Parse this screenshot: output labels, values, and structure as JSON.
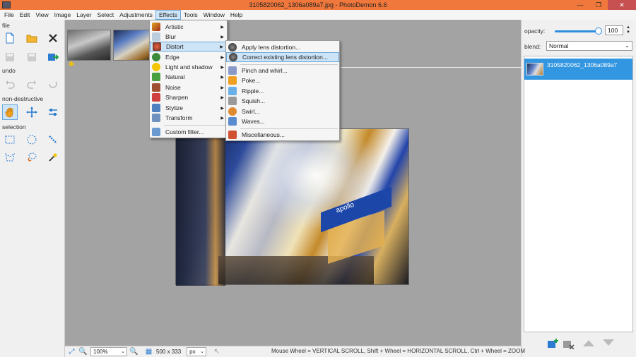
{
  "window": {
    "title": "3105820062_1306a089a7.jpg  -  PhotoDemon 6.6",
    "min": "—",
    "max": "❐",
    "close": "✕"
  },
  "menubar": [
    "File",
    "Edit",
    "View",
    "Image",
    "Layer",
    "Select",
    "Adjustments",
    "Effects",
    "Tools",
    "Window",
    "Help"
  ],
  "active_menu": "Effects",
  "toolbox": {
    "file_label": "file",
    "undo_label": "undo",
    "nondestructive_label": "non-destructive",
    "selection_label": "selection"
  },
  "effects_menu": {
    "items": [
      "Artistic",
      "Blur",
      "Distort",
      "Edge",
      "Light and shadow",
      "Natural",
      "Noise",
      "Sharpen",
      "Stylize",
      "Transform"
    ],
    "custom": "Custom filter...",
    "highlighted": "Distort"
  },
  "distort_menu": {
    "items": [
      "Apply lens distortion...",
      "Correct existing lens distortion..."
    ],
    "items2": [
      "Pinch and whirl...",
      "Poke...",
      "Ripple...",
      "Squish...",
      "Swirl...",
      "Waves..."
    ],
    "misc": "Miscellaneous...",
    "highlighted": "Correct existing lens distortion..."
  },
  "photo": {
    "sign": "apollo"
  },
  "right_panel": {
    "opacity_label": "opacity:",
    "opacity_value": "100",
    "blend_label": "blend:",
    "blend_value": "Normal",
    "layer_name": "3105820062_1306a089a7"
  },
  "statusbar": {
    "zoom": "100%",
    "size": "500 x 333",
    "unit": "px",
    "hint": "Mouse Wheel = VERTICAL SCROLL,  Shift + Wheel = HORIZONTAL SCROLL,  Ctrl + Wheel = ZOOM"
  },
  "colors": {
    "titlebar": "#f0783c",
    "accent": "#3396e0",
    "fab": "#1fa14b"
  }
}
